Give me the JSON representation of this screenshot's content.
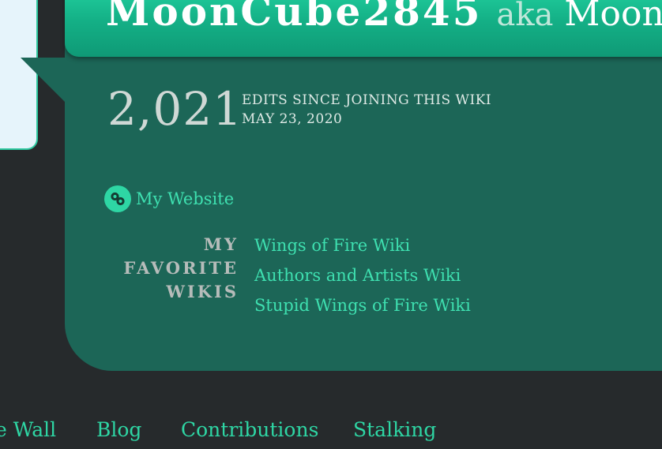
{
  "profile": {
    "username": "MoonCube2845",
    "aka": "aka",
    "nickname": "Moon"
  },
  "edits": {
    "count": "2,021",
    "label": "EDITS SINCE JOINING THIS WIKI",
    "join_date": "MAY 23, 2020"
  },
  "website": {
    "label": "My Website",
    "icon": "link-icon"
  },
  "favorite_wikis": {
    "label_lines": [
      "MY",
      "FAVORITE",
      "WIKIS"
    ],
    "items": [
      "Wings of Fire Wiki",
      "Authors and Artists Wiki",
      "Stupid Wings of Fire Wiki"
    ]
  },
  "nav": {
    "items": [
      "e Wall",
      "Blog",
      "Contributions",
      "Stalking"
    ]
  },
  "colors": {
    "accent": "#2ed6a4",
    "panel": "#1c6657",
    "background": "#262a2c",
    "title_gradient_top": "#25d9a6"
  }
}
